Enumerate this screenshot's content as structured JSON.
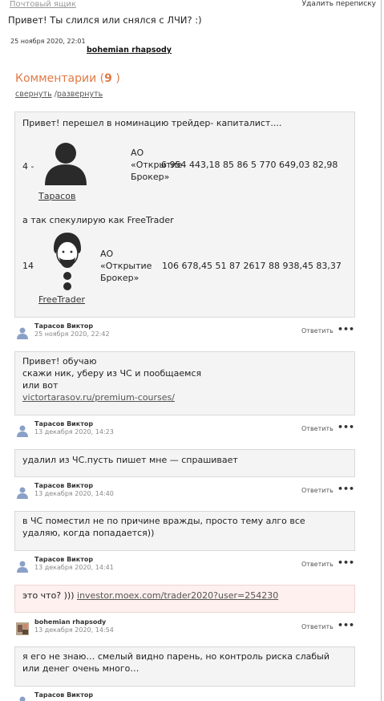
{
  "header": {
    "mailbox_link": "Почтовый ящик",
    "delete_thread": "Удалить переписку"
  },
  "message": {
    "text": "Привет! Ты слился или снялся с ЛЧИ? :)",
    "date": "25 ноября 2020, 22:01",
    "author": "bohemian rhapsody"
  },
  "comments_section": {
    "title": "Комментарии (",
    "count": "9",
    "title_end": " )",
    "collapse": "свернуть",
    "separator": " /",
    "expand": "развернуть"
  },
  "comments": [
    {
      "intro": "Привет! перешел в номинацию трейдер- капиталист....",
      "row1": {
        "num": "4 -",
        "name": "Тарасов",
        "company_line1": "АО",
        "company_line2": "«Открытие",
        "company_line3": "Брокер»",
        "values": "6 954 443,18 85 86 5 770 649,03 82,98"
      },
      "middle": "а так спекулирую как FreeTrader",
      "row2": {
        "num": "14",
        "name": "FreeTrader",
        "company_line1": "АО",
        "company_line2": "«Открытие",
        "company_line3": "Брокер»",
        "values": "106 678,45 51 87 2617 88 938,45 83,37"
      },
      "author": "Тарасов Виктор",
      "date": "25 ноября 2020, 22:42",
      "reply": "Ответить",
      "more": "•••"
    },
    {
      "line1": "Привет! обучаю",
      "line2": "скажи ник, уберу из ЧС и пообщаемся",
      "line3": "или вот",
      "link": "victortarasov.ru/premium-courses/",
      "author": "Тарасов Виктор",
      "date": "13 декабря 2020, 14:23",
      "reply": "Ответить",
      "more": "•••"
    },
    {
      "line1": "удалил из ЧС.пусть пишет мне — спрашивает",
      "author": "Тарасов Виктор",
      "date": "13 декабря 2020, 14:40",
      "reply": "Ответить",
      "more": "•••"
    },
    {
      "line1": "в ЧС поместил не по причине вражды, просто тему алго все",
      "line2": "удаляю, когда попадается))",
      "author": "Тарасов Виктор",
      "date": "13 декабря 2020, 14:41",
      "reply": "Ответить",
      "more": "•••"
    },
    {
      "prefix": "это что? ))) ",
      "link": "investor.moex.com/trader2020?user=254230",
      "author": "bohemian rhapsody",
      "date": "13 декабря 2020, 14:54",
      "reply": "Ответить",
      "more": "•••"
    },
    {
      "line1": "я его не знаю… смелый видно парень, но контроль риска слабый",
      "line2": "или денег очень много…",
      "author": "Тарасов Виктор"
    }
  ]
}
